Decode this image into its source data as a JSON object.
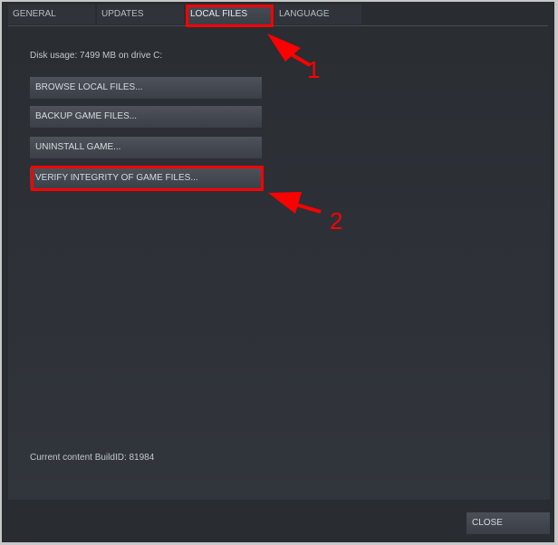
{
  "tabs": [
    {
      "label": "GENERAL",
      "active": false
    },
    {
      "label": "UPDATES",
      "active": false
    },
    {
      "label": "LOCAL FILES",
      "active": true
    },
    {
      "label": "LANGUAGE",
      "active": false
    }
  ],
  "local_files": {
    "disk_usage": "Disk usage: 7499 MB on drive C:",
    "buttons": [
      {
        "label": "BROWSE LOCAL FILES..."
      },
      {
        "label": "BACKUP GAME FILES..."
      },
      {
        "label": "UNINSTALL GAME..."
      },
      {
        "label": "VERIFY INTEGRITY OF GAME FILES..."
      }
    ],
    "build_id": "Current content BuildID: 81984"
  },
  "footer": {
    "close_label": "CLOSE"
  },
  "annotations": {
    "color": "#ff0000",
    "step1": "1",
    "step2": "2"
  }
}
